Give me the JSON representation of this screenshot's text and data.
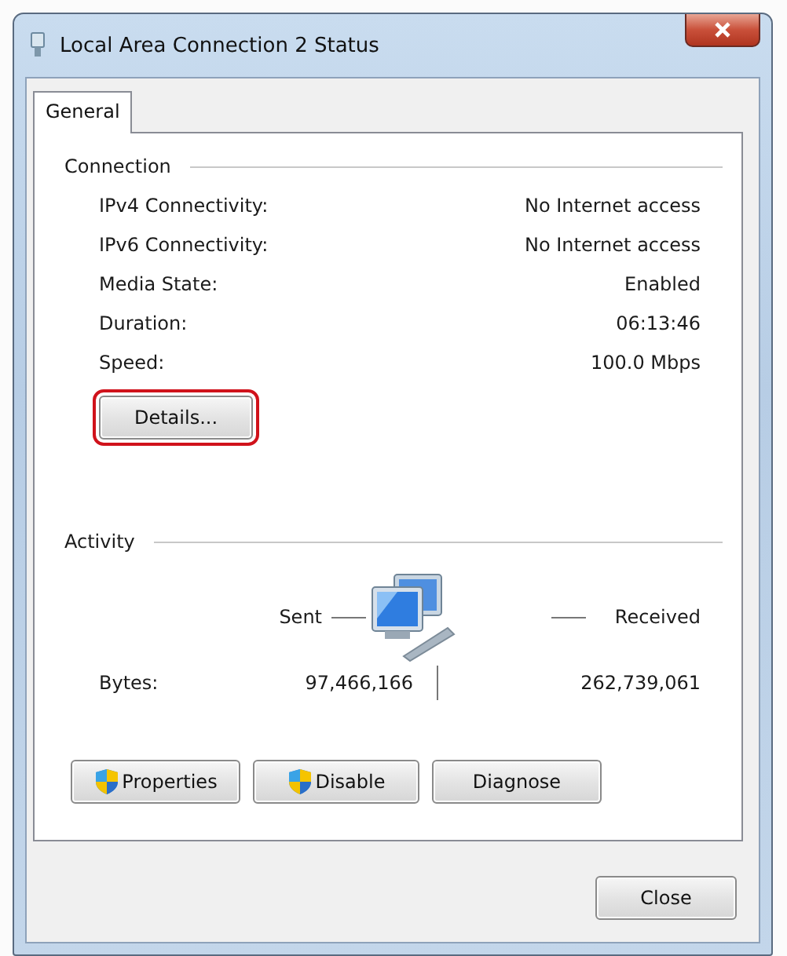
{
  "window": {
    "title": "Local Area Connection 2 Status"
  },
  "tabs": [
    {
      "label": "General",
      "selected": true
    }
  ],
  "connection": {
    "heading": "Connection",
    "rows": [
      {
        "label": "IPv4 Connectivity:",
        "value": "No Internet access"
      },
      {
        "label": "IPv6 Connectivity:",
        "value": "No Internet access"
      },
      {
        "label": "Media State:",
        "value": "Enabled"
      },
      {
        "label": "Duration:",
        "value": "06:13:46"
      },
      {
        "label": "Speed:",
        "value": "100.0 Mbps"
      }
    ],
    "details_button": {
      "label": "Details...",
      "highlighted": true
    }
  },
  "activity": {
    "heading": "Activity",
    "sent_label": "Sent",
    "received_label": "Received",
    "bytes_label": "Bytes:",
    "bytes_sent": "97,466,166",
    "bytes_received": "262,739,061"
  },
  "buttons": [
    {
      "label": "Properties",
      "kind": "shield"
    },
    {
      "label": "Disable",
      "kind": "shield"
    },
    {
      "label": "Diagnose",
      "kind": "plain"
    }
  ],
  "footer_buttons": [
    {
      "label": "Close"
    }
  ]
}
